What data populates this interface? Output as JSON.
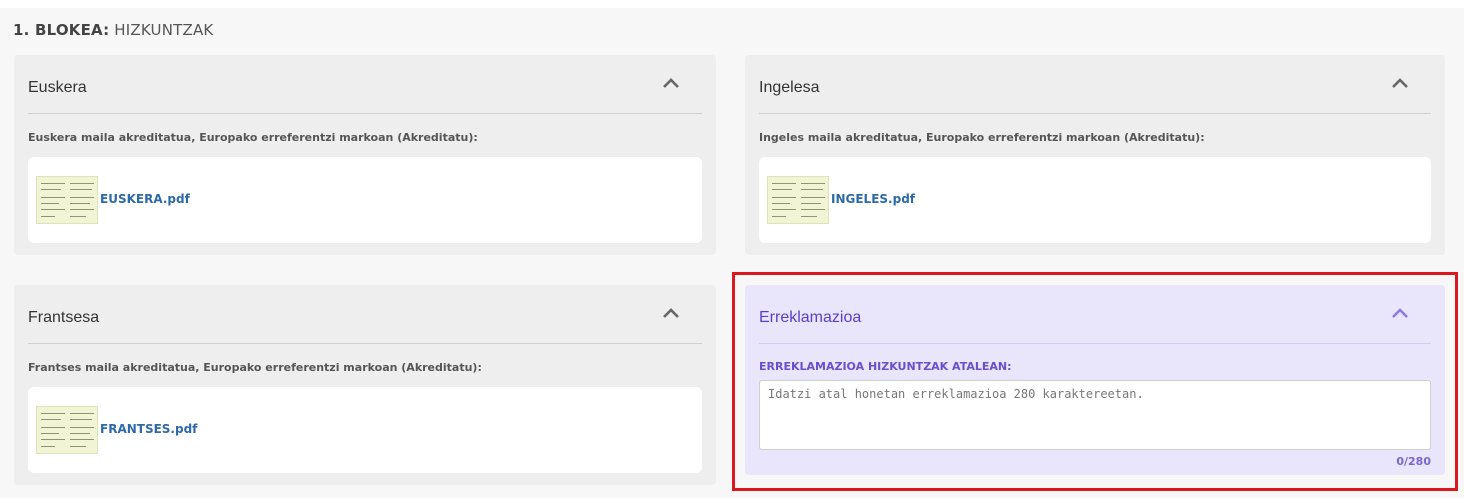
{
  "block": {
    "number": "1. BLOKEA:",
    "name": "HIZKUNTZAK"
  },
  "panels": [
    {
      "title": "Euskera",
      "label": "Euskera maila akreditatua, Europako erreferentzi markoan (Akreditatu):",
      "file": "EUSKERA.pdf"
    },
    {
      "title": "Ingelesa",
      "label": "Ingeles maila akreditatua, Europako erreferentzi markoan (Akreditatu):",
      "file": "INGELES.pdf"
    },
    {
      "title": "Frantsesa",
      "label": "Frantses maila akreditatua, Europako erreferentzi markoan (Akreditatu):",
      "file": "FRANTSES.pdf"
    }
  ],
  "claim": {
    "title": "Erreklamazioa",
    "label": "ERREKLAMAZIOA HIZKUNTZAK ATALEAN:",
    "placeholder": "Idatzi atal honetan erreklamazioa 280 karaktereetan.",
    "value": "",
    "counter": "0/280"
  },
  "icons": {
    "collapse": "chevron-up-icon",
    "document": "document-thumbnail-icon"
  },
  "colors": {
    "accent": "#5b3fc4",
    "link": "#2e6aa8",
    "highlight": "#d9181f",
    "claim_bg": "#e9e5fb"
  }
}
